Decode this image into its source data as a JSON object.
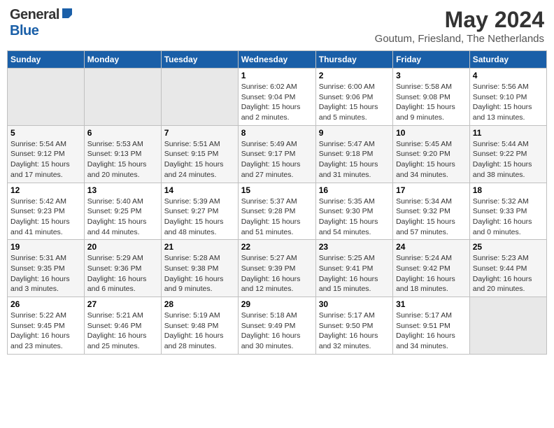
{
  "header": {
    "logo_general": "General",
    "logo_blue": "Blue",
    "month_year": "May 2024",
    "location": "Goutum, Friesland, The Netherlands"
  },
  "weekdays": [
    "Sunday",
    "Monday",
    "Tuesday",
    "Wednesday",
    "Thursday",
    "Friday",
    "Saturday"
  ],
  "weeks": [
    [
      {
        "day": "",
        "info": ""
      },
      {
        "day": "",
        "info": ""
      },
      {
        "day": "",
        "info": ""
      },
      {
        "day": "1",
        "info": "Sunrise: 6:02 AM\nSunset: 9:04 PM\nDaylight: 15 hours\nand 2 minutes."
      },
      {
        "day": "2",
        "info": "Sunrise: 6:00 AM\nSunset: 9:06 PM\nDaylight: 15 hours\nand 5 minutes."
      },
      {
        "day": "3",
        "info": "Sunrise: 5:58 AM\nSunset: 9:08 PM\nDaylight: 15 hours\nand 9 minutes."
      },
      {
        "day": "4",
        "info": "Sunrise: 5:56 AM\nSunset: 9:10 PM\nDaylight: 15 hours\nand 13 minutes."
      }
    ],
    [
      {
        "day": "5",
        "info": "Sunrise: 5:54 AM\nSunset: 9:12 PM\nDaylight: 15 hours\nand 17 minutes."
      },
      {
        "day": "6",
        "info": "Sunrise: 5:53 AM\nSunset: 9:13 PM\nDaylight: 15 hours\nand 20 minutes."
      },
      {
        "day": "7",
        "info": "Sunrise: 5:51 AM\nSunset: 9:15 PM\nDaylight: 15 hours\nand 24 minutes."
      },
      {
        "day": "8",
        "info": "Sunrise: 5:49 AM\nSunset: 9:17 PM\nDaylight: 15 hours\nand 27 minutes."
      },
      {
        "day": "9",
        "info": "Sunrise: 5:47 AM\nSunset: 9:18 PM\nDaylight: 15 hours\nand 31 minutes."
      },
      {
        "day": "10",
        "info": "Sunrise: 5:45 AM\nSunset: 9:20 PM\nDaylight: 15 hours\nand 34 minutes."
      },
      {
        "day": "11",
        "info": "Sunrise: 5:44 AM\nSunset: 9:22 PM\nDaylight: 15 hours\nand 38 minutes."
      }
    ],
    [
      {
        "day": "12",
        "info": "Sunrise: 5:42 AM\nSunset: 9:23 PM\nDaylight: 15 hours\nand 41 minutes."
      },
      {
        "day": "13",
        "info": "Sunrise: 5:40 AM\nSunset: 9:25 PM\nDaylight: 15 hours\nand 44 minutes."
      },
      {
        "day": "14",
        "info": "Sunrise: 5:39 AM\nSunset: 9:27 PM\nDaylight: 15 hours\nand 48 minutes."
      },
      {
        "day": "15",
        "info": "Sunrise: 5:37 AM\nSunset: 9:28 PM\nDaylight: 15 hours\nand 51 minutes."
      },
      {
        "day": "16",
        "info": "Sunrise: 5:35 AM\nSunset: 9:30 PM\nDaylight: 15 hours\nand 54 minutes."
      },
      {
        "day": "17",
        "info": "Sunrise: 5:34 AM\nSunset: 9:32 PM\nDaylight: 15 hours\nand 57 minutes."
      },
      {
        "day": "18",
        "info": "Sunrise: 5:32 AM\nSunset: 9:33 PM\nDaylight: 16 hours\nand 0 minutes."
      }
    ],
    [
      {
        "day": "19",
        "info": "Sunrise: 5:31 AM\nSunset: 9:35 PM\nDaylight: 16 hours\nand 3 minutes."
      },
      {
        "day": "20",
        "info": "Sunrise: 5:29 AM\nSunset: 9:36 PM\nDaylight: 16 hours\nand 6 minutes."
      },
      {
        "day": "21",
        "info": "Sunrise: 5:28 AM\nSunset: 9:38 PM\nDaylight: 16 hours\nand 9 minutes."
      },
      {
        "day": "22",
        "info": "Sunrise: 5:27 AM\nSunset: 9:39 PM\nDaylight: 16 hours\nand 12 minutes."
      },
      {
        "day": "23",
        "info": "Sunrise: 5:25 AM\nSunset: 9:41 PM\nDaylight: 16 hours\nand 15 minutes."
      },
      {
        "day": "24",
        "info": "Sunrise: 5:24 AM\nSunset: 9:42 PM\nDaylight: 16 hours\nand 18 minutes."
      },
      {
        "day": "25",
        "info": "Sunrise: 5:23 AM\nSunset: 9:44 PM\nDaylight: 16 hours\nand 20 minutes."
      }
    ],
    [
      {
        "day": "26",
        "info": "Sunrise: 5:22 AM\nSunset: 9:45 PM\nDaylight: 16 hours\nand 23 minutes."
      },
      {
        "day": "27",
        "info": "Sunrise: 5:21 AM\nSunset: 9:46 PM\nDaylight: 16 hours\nand 25 minutes."
      },
      {
        "day": "28",
        "info": "Sunrise: 5:19 AM\nSunset: 9:48 PM\nDaylight: 16 hours\nand 28 minutes."
      },
      {
        "day": "29",
        "info": "Sunrise: 5:18 AM\nSunset: 9:49 PM\nDaylight: 16 hours\nand 30 minutes."
      },
      {
        "day": "30",
        "info": "Sunrise: 5:17 AM\nSunset: 9:50 PM\nDaylight: 16 hours\nand 32 minutes."
      },
      {
        "day": "31",
        "info": "Sunrise: 5:17 AM\nSunset: 9:51 PM\nDaylight: 16 hours\nand 34 minutes."
      },
      {
        "day": "",
        "info": ""
      }
    ]
  ]
}
